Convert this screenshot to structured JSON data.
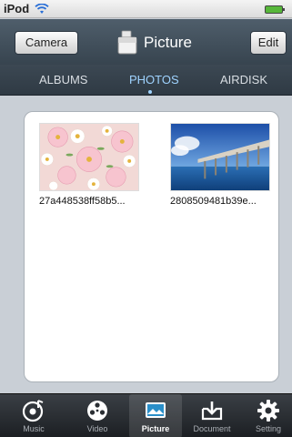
{
  "status": {
    "carrier": "iPod"
  },
  "nav": {
    "left_button": "Camera",
    "title": "Picture",
    "right_button": "Edit"
  },
  "segments": [
    {
      "label": "ALBUMS"
    },
    {
      "label": "PHOTOS",
      "selected": true
    },
    {
      "label": "AIRDISK"
    }
  ],
  "photos": [
    {
      "caption": "27a448538ff58b5..."
    },
    {
      "caption": "2808509481b39e..."
    }
  ],
  "tabbar": [
    {
      "label": "Music"
    },
    {
      "label": "Video"
    },
    {
      "label": "Picture",
      "selected": true
    },
    {
      "label": "Document"
    },
    {
      "label": "Setting"
    }
  ],
  "colors": {
    "accent": "#9fd3ff",
    "navbar": "#4f5e6b",
    "battery": "#57b73a"
  }
}
